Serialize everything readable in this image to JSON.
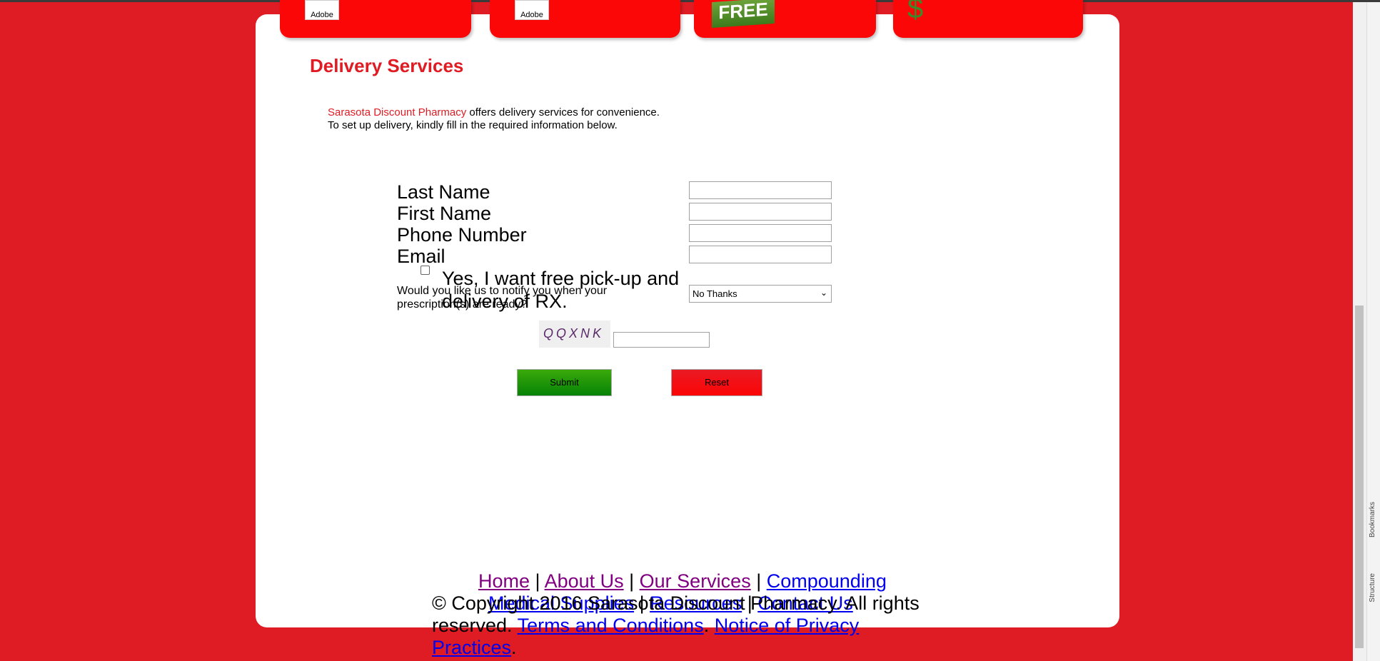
{
  "tabs": [
    {
      "icon": "adobe-pdf-icon",
      "label": "Adobe"
    },
    {
      "icon": "adobe-pdf-icon",
      "label": "Adobe"
    },
    {
      "icon": "free-badge-icon",
      "label": "FREE"
    },
    {
      "icon": "dollar-icon",
      "label": "$"
    }
  ],
  "page_title": "Delivery Services",
  "intro": {
    "brand": "Sarasota Discount Pharmacy",
    "line1_rest": " offers delivery services for convenience.",
    "line2": "To set up delivery, kindly fill in the required information below."
  },
  "form": {
    "last_name": "Last Name",
    "first_name": "First Name",
    "phone": "Phone Number",
    "email": "Email",
    "pickup_label": "Yes, I want free pick-up and delivery of RX.",
    "notify_label": "Would you like us to notify you when your prescription(s) are ready?",
    "notify_selected": "No Thanks",
    "captcha_text": "QQXNK",
    "submit": "Submit",
    "reset": "Reset"
  },
  "footer": {
    "nav": [
      "Home",
      "About Us",
      "Our Services",
      "Compounding",
      "Medical Supplies",
      "Resources",
      "Contact Us"
    ],
    "sep": " | ",
    "copyright": "© Copyright 2016 Sarasota Discount Pharmacy. All rights reserved. ",
    "terms": "Terms and Conditions",
    "privacy": "Notice of Privacy Practices"
  },
  "sidebar": {
    "bookmarks": "Bookmarks",
    "structure": "Structure"
  },
  "colors": {
    "brand_red": "#df1c24",
    "tab_red": "#fb0707",
    "submit_green": "#1a9606",
    "visited_link": "#800080",
    "link": "#0000ee"
  }
}
